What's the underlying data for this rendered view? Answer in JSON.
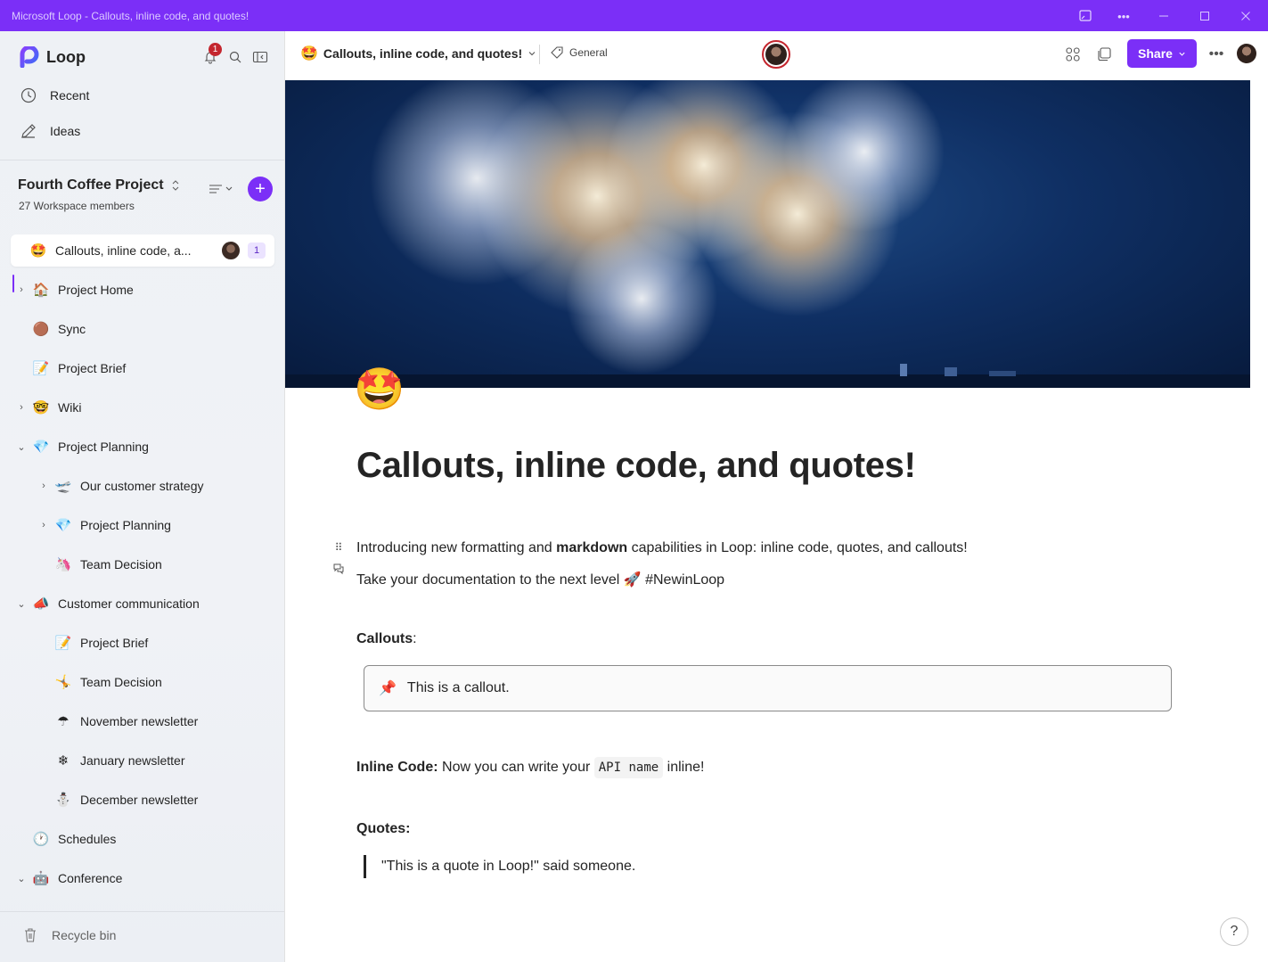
{
  "window": {
    "title": "Microsoft Loop - Callouts, inline code, and quotes!"
  },
  "sidebar": {
    "app_name": "Loop",
    "notification_count": "1",
    "nav": [
      {
        "label": "Recent",
        "icon": "clock-icon"
      },
      {
        "label": "Ideas",
        "icon": "pen-icon"
      }
    ],
    "workspace": {
      "name": "Fourth Coffee Project",
      "members": "27 Workspace members"
    },
    "active_page": {
      "label": "Callouts, inline code, a...",
      "icon": "star-struck-emoji",
      "badge": "1"
    },
    "tree": [
      {
        "label": "Project Home",
        "emoji": "🏠",
        "chevron": "›"
      },
      {
        "label": "Sync",
        "emoji": "🟤",
        "chevron": ""
      },
      {
        "label": "Project Brief",
        "emoji": "📝",
        "chevron": ""
      },
      {
        "label": "Wiki",
        "emoji": "🤓",
        "chevron": "›"
      },
      {
        "label": "Project Planning",
        "emoji": "💎",
        "chevron": "⌄"
      },
      {
        "label": "Our customer strategy",
        "emoji": "🛫",
        "chevron": "›"
      },
      {
        "label": "Project Planning",
        "emoji": "💎",
        "chevron": "›"
      },
      {
        "label": "Team Decision",
        "emoji": "🦄",
        "chevron": ""
      },
      {
        "label": "Customer communication",
        "emoji": "📣",
        "chevron": "⌄"
      },
      {
        "label": "Project Brief",
        "emoji": "📝",
        "chevron": ""
      },
      {
        "label": "Team Decision",
        "emoji": "🤸",
        "chevron": ""
      },
      {
        "label": "November newsletter",
        "emoji": "☂",
        "chevron": ""
      },
      {
        "label": "January newsletter",
        "emoji": "❄",
        "chevron": ""
      },
      {
        "label": "December newsletter",
        "emoji": "⛄",
        "chevron": ""
      },
      {
        "label": "Schedules",
        "emoji": "🕐",
        "chevron": ""
      },
      {
        "label": "Conference",
        "emoji": "🤖",
        "chevron": "⌄"
      }
    ],
    "recycle_bin": "Recycle bin"
  },
  "header": {
    "page_title": "Callouts, inline code, and quotes!",
    "tag_label": "General",
    "share_label": "Share"
  },
  "document": {
    "title": "Callouts, inline code, and quotes!",
    "intro_1a": "Introducing new formatting and ",
    "intro_1b": "markdown",
    "intro_1c": " capabilities in Loop: inline code, quotes, and callouts!",
    "intro_2a": "Take your documentation to the next level ",
    "intro_2b": "🚀",
    "intro_2c": " #NewinLoop",
    "callouts_heading": "Callouts",
    "callouts_colon": ":",
    "callout_icon": "📌",
    "callout_text": "This is a callout.",
    "inline_heading": "Inline Code:",
    "inline_before": " Now you can write your ",
    "inline_code": "API name",
    "inline_after": " inline!",
    "quotes_heading": "Quotes:",
    "quote_text": "\"This is a quote in Loop!\" said someone."
  },
  "colors": {
    "accent": "#7b2ff7",
    "notification": "#c4262e"
  }
}
